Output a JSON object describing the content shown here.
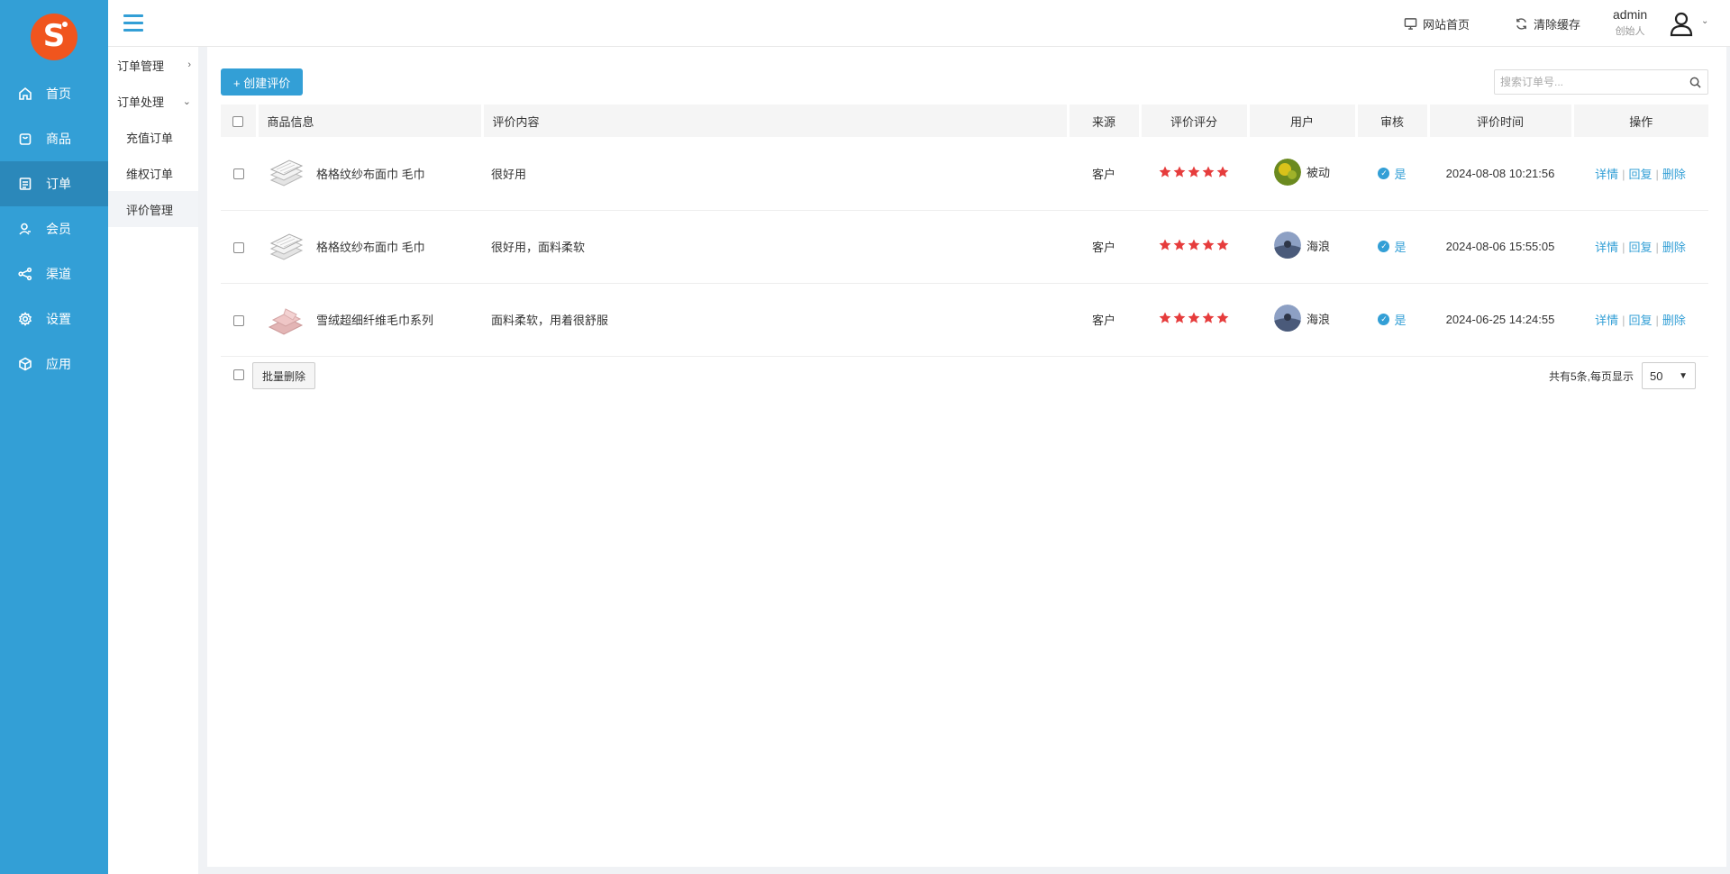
{
  "sidebar": {
    "items": [
      {
        "label": "首页",
        "icon": "home-icon"
      },
      {
        "label": "商品",
        "icon": "bag-icon"
      },
      {
        "label": "订单",
        "icon": "list-icon"
      },
      {
        "label": "会员",
        "icon": "user-icon"
      },
      {
        "label": "渠道",
        "icon": "share-icon"
      },
      {
        "label": "设置",
        "icon": "gear-icon"
      },
      {
        "label": "应用",
        "icon": "cube-icon"
      }
    ],
    "active_index": 2
  },
  "subnav": {
    "group1": "订单管理",
    "group2": "订单处理",
    "items": [
      "充值订单",
      "维权订单",
      "评价管理"
    ],
    "active": "评价管理"
  },
  "header": {
    "site_home": "网站首页",
    "clear_cache": "清除缓存",
    "user_name": "admin",
    "user_role": "创始人"
  },
  "toolbar": {
    "create_label": "+ 创建评价",
    "search_placeholder": "搜索订单号..."
  },
  "table": {
    "columns": [
      "商品信息",
      "评价内容",
      "来源",
      "评价评分",
      "用户",
      "审核",
      "评价时间",
      "操作"
    ],
    "rows": [
      {
        "product": "格格纹纱布面巾 毛巾",
        "content": "很好用",
        "source": "客户",
        "rating": 5,
        "user": "被动",
        "audit": "是",
        "time": "2024-08-08 10:21:56"
      },
      {
        "product": "格格纹纱布面巾 毛巾",
        "content": "很好用，面料柔软",
        "source": "客户",
        "rating": 5,
        "user": "海浪",
        "audit": "是",
        "time": "2024-08-06 15:55:05"
      },
      {
        "product": "雪绒超细纤维毛巾系列",
        "content": "面料柔软，用着很舒服",
        "source": "客户",
        "rating": 5,
        "user": "海浪",
        "audit": "是",
        "time": "2024-06-25 14:24:55"
      }
    ],
    "ops": {
      "detail": "详情",
      "reply": "回复",
      "delete": "删除"
    }
  },
  "footer": {
    "batch_delete": "批量删除",
    "total_text": "共有5条,每页显示",
    "page_size": "50"
  },
  "colors": {
    "accent": "#339fd6",
    "logo": "#f0551e",
    "star": "#e63c3c"
  }
}
